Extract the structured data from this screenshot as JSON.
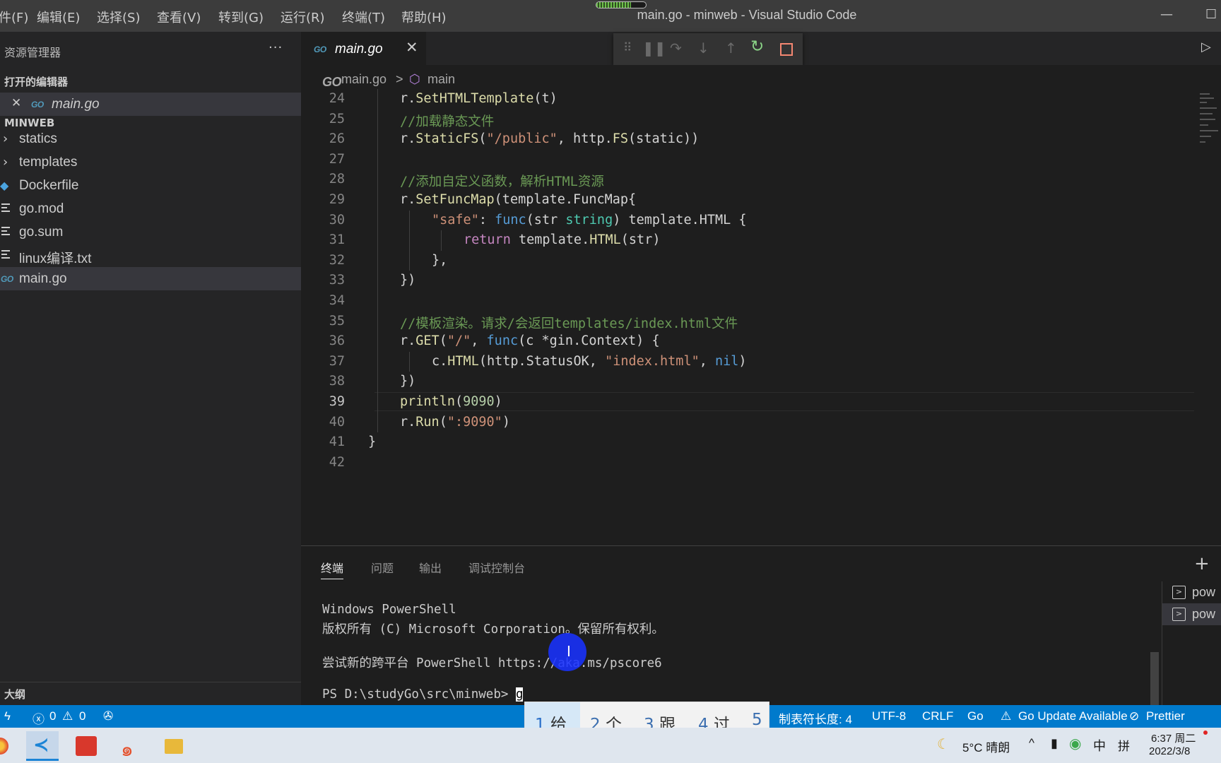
{
  "titlebar": {
    "menu": [
      "件(F)",
      "编辑(E)",
      "选择(S)",
      "查看(V)",
      "转到(G)",
      "运行(R)",
      "终端(T)",
      "帮助(H)"
    ],
    "title": "main.go - minweb - Visual Studio Code",
    "minimize": "—",
    "maximize": "☐"
  },
  "sidebar": {
    "header": "资源管理器",
    "more": "···",
    "open_editors_title": "打开的编辑器",
    "open_editor": {
      "close": "✕",
      "icon": "GO",
      "label": "main.go"
    },
    "folder_title": "MINWEB",
    "items": [
      {
        "type": "folder",
        "label": "statics"
      },
      {
        "type": "folder",
        "label": "templates"
      },
      {
        "type": "docker",
        "label": "Dockerfile"
      },
      {
        "type": "text",
        "label": "go.mod"
      },
      {
        "type": "text",
        "label": "go.sum"
      },
      {
        "type": "text",
        "label": "linux编译.txt"
      },
      {
        "type": "go",
        "label": "main.go",
        "selected": true
      }
    ],
    "outline_title": "大纲"
  },
  "editor": {
    "tab": {
      "icon": "GO",
      "label": "main.go",
      "close": "✕"
    },
    "breadcrumb": {
      "icon": "GO",
      "file": "main.go",
      "sep": ">",
      "symbol_icon": "⬡",
      "symbol": "main"
    },
    "current_line": 39,
    "lines": [
      {
        "n": "24",
        "indent": 1,
        "tokens": [
          [
            "",
            "r."
          ],
          [
            "fn",
            "SetHTMLTemplate"
          ],
          [
            "",
            "(t)"
          ]
        ]
      },
      {
        "n": "25",
        "indent": 1,
        "tokens": [
          [
            "cmt",
            "//加载静态文件"
          ]
        ]
      },
      {
        "n": "26",
        "indent": 1,
        "tokens": [
          [
            "",
            "r."
          ],
          [
            "fn",
            "StaticFS"
          ],
          [
            "",
            "("
          ],
          [
            "str",
            "\"/public\""
          ],
          [
            "",
            ", http."
          ],
          [
            "fn",
            "FS"
          ],
          [
            "",
            "(static))"
          ]
        ]
      },
      {
        "n": "27",
        "indent": 1,
        "tokens": []
      },
      {
        "n": "28",
        "indent": 1,
        "tokens": [
          [
            "cmt",
            "//添加自定义函数，解析HTML资源"
          ]
        ]
      },
      {
        "n": "29",
        "indent": 1,
        "tokens": [
          [
            "",
            "r."
          ],
          [
            "fn",
            "SetFuncMap"
          ],
          [
            "",
            "(template.FuncMap{"
          ]
        ]
      },
      {
        "n": "30",
        "indent": 2,
        "tokens": [
          [
            "str",
            "\"safe\""
          ],
          [
            "",
            ": "
          ],
          [
            "kw",
            "func"
          ],
          [
            "",
            "(str "
          ],
          [
            "type",
            "string"
          ],
          [
            "",
            ") template.HTML {"
          ]
        ]
      },
      {
        "n": "31",
        "indent": 3,
        "tokens": [
          [
            "ctl",
            "return"
          ],
          [
            "",
            " template."
          ],
          [
            "fn",
            "HTML"
          ],
          [
            "",
            "(str)"
          ]
        ]
      },
      {
        "n": "32",
        "indent": 2,
        "tokens": [
          [
            "",
            "},"
          ]
        ]
      },
      {
        "n": "33",
        "indent": 1,
        "tokens": [
          [
            "",
            "})"
          ]
        ]
      },
      {
        "n": "34",
        "indent": 1,
        "tokens": []
      },
      {
        "n": "35",
        "indent": 1,
        "tokens": [
          [
            "cmt",
            "//模板渲染。请求/会返回templates/index.html文件"
          ]
        ]
      },
      {
        "n": "36",
        "indent": 1,
        "tokens": [
          [
            "",
            "r."
          ],
          [
            "fn",
            "GET"
          ],
          [
            "",
            "("
          ],
          [
            "str",
            "\"/\""
          ],
          [
            "",
            ", "
          ],
          [
            "kw",
            "func"
          ],
          [
            "",
            "(c *gin.Context) {"
          ]
        ]
      },
      {
        "n": "37",
        "indent": 2,
        "tokens": [
          [
            "",
            "c."
          ],
          [
            "fn",
            "HTML"
          ],
          [
            "",
            "(http.StatusOK, "
          ],
          [
            "str",
            "\"index.html\""
          ],
          [
            "",
            ", "
          ],
          [
            "kw",
            "nil"
          ],
          [
            "",
            ")"
          ]
        ]
      },
      {
        "n": "38",
        "indent": 1,
        "tokens": [
          [
            "",
            "})"
          ]
        ]
      },
      {
        "n": "39",
        "indent": 1,
        "tokens": [
          [
            "fn",
            "println"
          ],
          [
            "",
            "("
          ],
          [
            "num",
            "9090"
          ],
          [
            "",
            ")"
          ]
        ]
      },
      {
        "n": "40",
        "indent": 1,
        "tokens": [
          [
            "",
            "r."
          ],
          [
            "fn",
            "Run"
          ],
          [
            "",
            "("
          ],
          [
            "str",
            "\":9090\""
          ],
          [
            "",
            ")"
          ]
        ]
      },
      {
        "n": "41",
        "indent": 0,
        "tokens": [
          [
            "",
            "}"
          ]
        ]
      },
      {
        "n": "42",
        "indent": 0,
        "tokens": []
      }
    ]
  },
  "panel": {
    "tabs": [
      "终端",
      "问题",
      "输出",
      "调试控制台"
    ],
    "active_tab": 0,
    "add": "+",
    "terminal_lines": [
      "Windows PowerShell",
      "版权所有 (C) Microsoft Corporation。保留所有权利。",
      "",
      "尝试新的跨平台 PowerShell https://aka.ms/pscore6",
      ""
    ],
    "prompt": "PS D:\\studyGo\\src\\minweb> ",
    "typed": "g",
    "terminals": [
      {
        "label": "pow"
      },
      {
        "label": "pow",
        "selected": true
      }
    ]
  },
  "statusbar": {
    "errors": "0",
    "warnings": "0",
    "tab_size": "制表符长度: 4",
    "encoding": "UTF-8",
    "eol": "CRLF",
    "language": "Go",
    "update": "Go Update Available",
    "formatter": "Prettier"
  },
  "ime": {
    "candidates": [
      {
        "n": "1",
        "text": "给"
      },
      {
        "n": "2",
        "text": "个"
      },
      {
        "n": "3",
        "text": "跟"
      },
      {
        "n": "4",
        "text": "过"
      },
      {
        "n": "5",
        "text": ""
      }
    ]
  },
  "taskbar": {
    "weather": "5°C  晴朗",
    "input_mode": "中",
    "layout": "拼",
    "time": "6:37 周二",
    "date": "2022/3/8"
  },
  "colors": {
    "accent": "#007acc",
    "editor_bg": "#1e1e1e",
    "sidebar_bg": "#252526",
    "titlebar_bg": "#3c3c3c",
    "go_icon": "#519aba",
    "restart_icon": "#89d185",
    "stop_icon": "#f48771"
  }
}
